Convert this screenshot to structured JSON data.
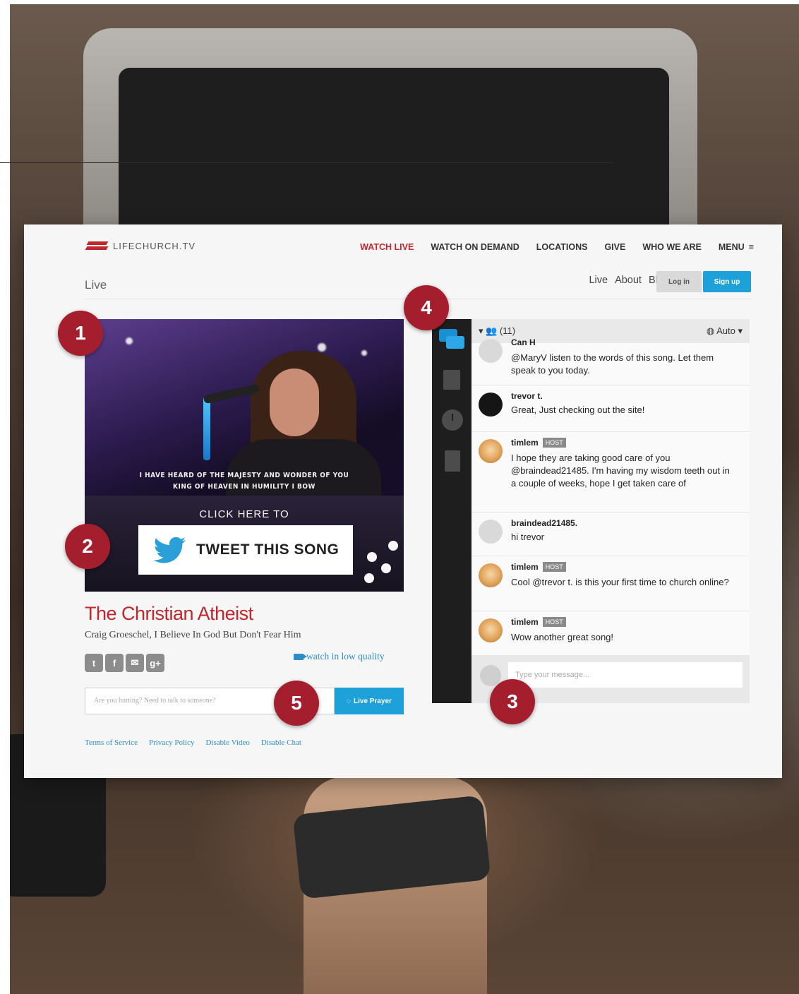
{
  "brand": {
    "logo_text": "LIFECHURCH.TV",
    "accent": "#c0272d",
    "link": "#2b8fc3",
    "button": "#1ea1d9"
  },
  "nav": {
    "items": [
      {
        "label": "WATCH LIVE",
        "active": true
      },
      {
        "label": "WATCH ON DEMAND"
      },
      {
        "label": "LOCATIONS"
      },
      {
        "label": "GIVE"
      },
      {
        "label": "WHO WE ARE"
      },
      {
        "label": "MENU"
      }
    ],
    "menu_icon": "hamburger-icon"
  },
  "subnav": {
    "page_label": "Live",
    "links": [
      "Live",
      "About",
      "Blog"
    ],
    "login": "Log in",
    "signup": "Sign up"
  },
  "video": {
    "lyrics_line1": "I HAVE HEARD OF THE MAJESTY AND WONDER OF YOU",
    "lyrics_line2": "KING OF HEAVEN IN HUMILITY I BOW",
    "click_here": "CLICK HERE TO",
    "tweet_label": "TWEET THIS SONG",
    "tweet_icon": "twitter-bird-icon"
  },
  "sermon": {
    "title": "The Christian Atheist",
    "subtitle": "Craig Groeschel, I Believe In God But Don't Fear Him",
    "share_icons": [
      "twitter-icon",
      "facebook-icon",
      "email-icon",
      "google-plus-icon"
    ],
    "share_glyphs": [
      "t",
      "f",
      "✉",
      "g+"
    ],
    "low_quality": "watch in low quality"
  },
  "prayer": {
    "placeholder": "Are you hurting? Need to talk to someone?",
    "button": "Live Prayer",
    "icon": "speech-bubble-icon"
  },
  "footer": {
    "links": [
      "Terms of Service",
      "Privacy Policy",
      "Disable Video",
      "Disable Chat"
    ]
  },
  "sidebar": {
    "icons": [
      "chat-icon",
      "list-icon",
      "clock-icon",
      "notes-icon"
    ]
  },
  "chat": {
    "users_count": "(11)",
    "auto_label": "Auto",
    "messages": [
      {
        "name": "Can H",
        "text": "@MaryV listen to the words of this song. Let them speak to you today.",
        "host": false
      },
      {
        "name": "trevor t.",
        "text": "Great, Just checking out the site!",
        "host": false
      },
      {
        "name": "timlem",
        "text": "I hope they are taking good care of you @braindead21485. I'm having my wisdom teeth out in a couple of weeks, hope I get taken care of",
        "host": true
      },
      {
        "name": "braindead21485.",
        "text": "hi trevor",
        "host": false
      },
      {
        "name": "timlem",
        "text": "Cool @trevor t. is this your first time to church online?",
        "host": true
      },
      {
        "name": "timlem",
        "text": "Wow another great song!",
        "host": true
      }
    ],
    "host_badge": "HOST",
    "compose_placeholder": "Type your message..."
  },
  "markers": [
    "1",
    "2",
    "3",
    "4",
    "5"
  ]
}
